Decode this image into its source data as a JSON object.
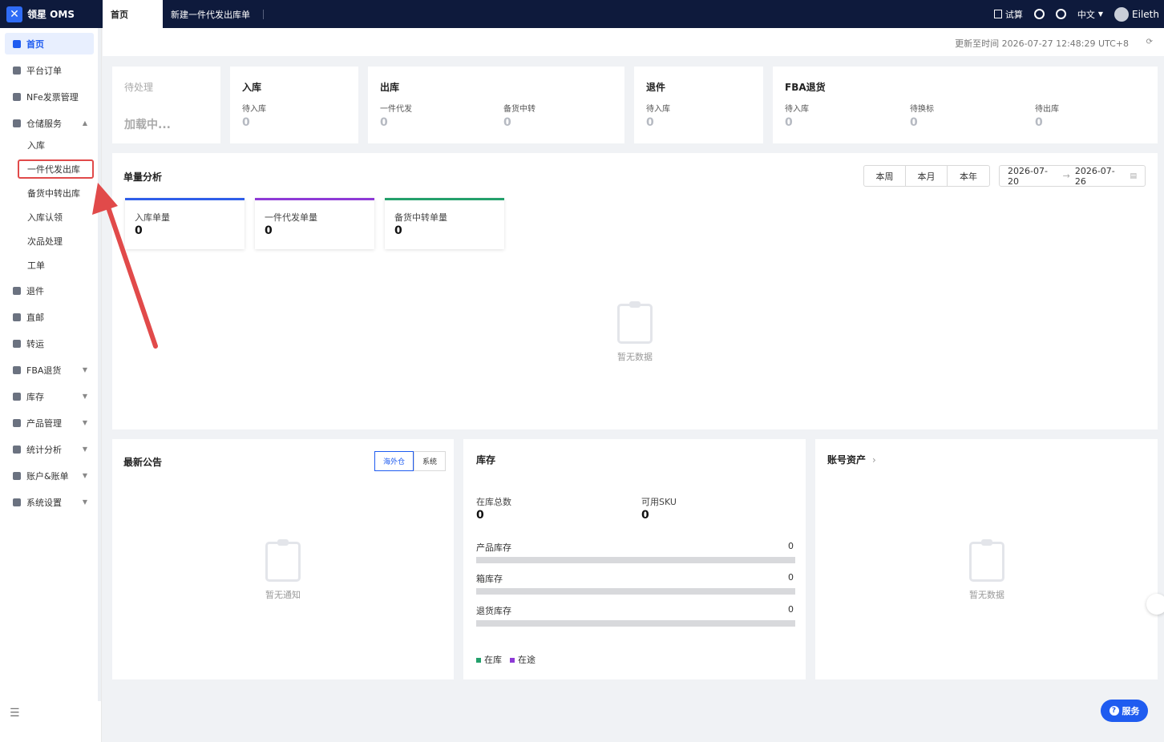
{
  "app": {
    "brand": "领星 OMS"
  },
  "tabs": [
    {
      "label": "首页"
    },
    {
      "label": "新建一件代发出库单"
    }
  ],
  "topbar": {
    "trial": "试算",
    "language": "中文",
    "user": "Eileth"
  },
  "sidebar": {
    "items": [
      {
        "label": "首页"
      },
      {
        "label": "平台订单"
      },
      {
        "label": "NFe发票管理"
      },
      {
        "label": "仓储服务"
      },
      {
        "label": "退件"
      },
      {
        "label": "直邮"
      },
      {
        "label": "转运"
      },
      {
        "label": "FBA退货"
      },
      {
        "label": "库存"
      },
      {
        "label": "产品管理"
      },
      {
        "label": "统计分析"
      },
      {
        "label": "账户&账单"
      },
      {
        "label": "系统设置"
      }
    ],
    "warehouse_sub": [
      {
        "label": "入库"
      },
      {
        "label": "一件代发出库"
      },
      {
        "label": "备货中转出库"
      },
      {
        "label": "入库认领"
      },
      {
        "label": "次品处理"
      },
      {
        "label": "工单"
      }
    ]
  },
  "update": {
    "text": "更新至时间 2026-07-27 12:48:29 UTC+8"
  },
  "stats": {
    "pending": {
      "title": "待处理",
      "loading": "加载中..."
    },
    "inbound": {
      "title": "入库",
      "sub": "待入库",
      "value": "0"
    },
    "outbound": {
      "title": "出库",
      "sub1": "一件代发",
      "value1": "0",
      "sub2": "备货中转",
      "value2": "0"
    },
    "returns": {
      "title": "退件",
      "sub": "待入库",
      "value": "0"
    },
    "fba": {
      "title": "FBA退货",
      "sub1": "待入库",
      "value1": "0",
      "sub2": "待换标",
      "value2": "0",
      "sub3": "待出库",
      "value3": "0"
    }
  },
  "analysis": {
    "title": "单量分析",
    "ranges": [
      "本周",
      "本月",
      "本年"
    ],
    "date_from": "2026-07-20",
    "date_to": "2026-07-26",
    "kpis": [
      {
        "label": "入库单量",
        "value": "0",
        "color": "#2f5ee9"
      },
      {
        "label": "一件代发单量",
        "value": "0",
        "color": "#8e3ad6"
      },
      {
        "label": "备货中转单量",
        "value": "0",
        "color": "#23a06b"
      }
    ],
    "empty": "暂无数据"
  },
  "announce": {
    "title": "最新公告",
    "tabs": [
      "海外仓",
      "系统"
    ],
    "empty": "暂无通知"
  },
  "inventory": {
    "title": "库存",
    "total_label": "在库总数",
    "total_value": "0",
    "sku_label": "可用SKU",
    "sku_value": "0",
    "rows": [
      {
        "label": "产品库存",
        "value": "0"
      },
      {
        "label": "箱库存",
        "value": "0"
      },
      {
        "label": "退货库存",
        "value": "0"
      }
    ],
    "legend": [
      {
        "label": "在库",
        "color": "#23a06b"
      },
      {
        "label": "在途",
        "color": "#8e3ad6"
      }
    ]
  },
  "account": {
    "title": "账号资产",
    "empty": "暂无数据"
  },
  "service": {
    "label": "服务"
  }
}
